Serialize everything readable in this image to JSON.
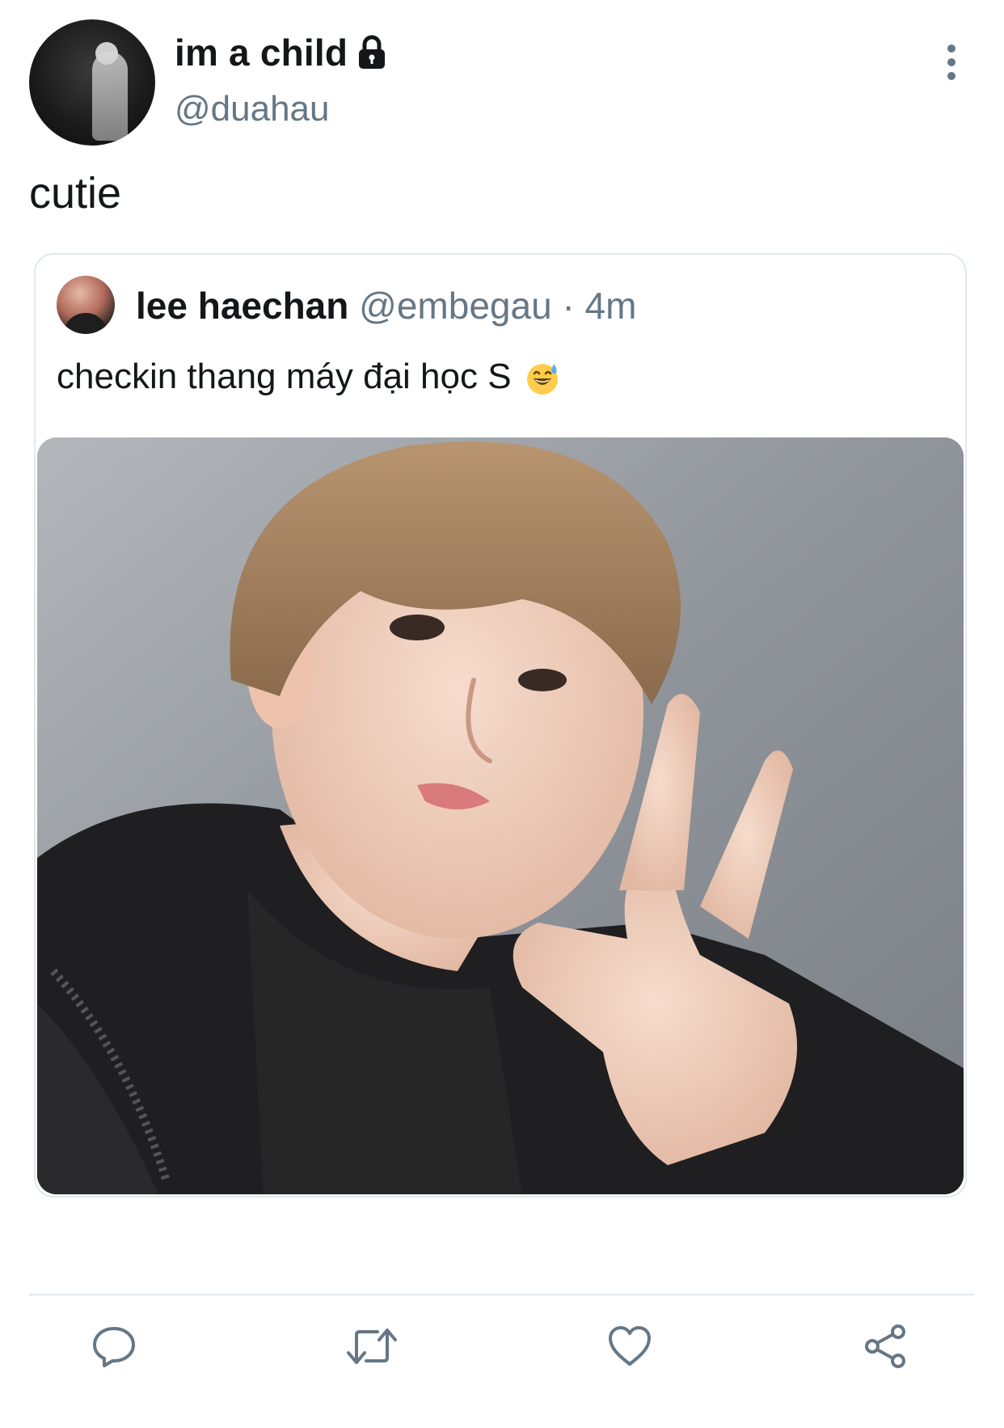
{
  "tweet": {
    "display_name": "im a child",
    "handle": "@duahau",
    "text": "cutie",
    "protected": true
  },
  "quoted_tweet": {
    "display_name": "lee haechan",
    "handle": "@embegau",
    "separator": "·",
    "time": "4m",
    "text": "checkin thang máy đại học S",
    "emoji": "grinning-face-with-sweat"
  },
  "actions": {
    "icons": [
      "reply-icon",
      "retweet-icon",
      "like-icon",
      "share-icon"
    ]
  },
  "colors": {
    "text": "#14171a",
    "secondary": "#657786",
    "border": "#e1e8ed",
    "emoji_yellow": "#ffcc4d"
  }
}
